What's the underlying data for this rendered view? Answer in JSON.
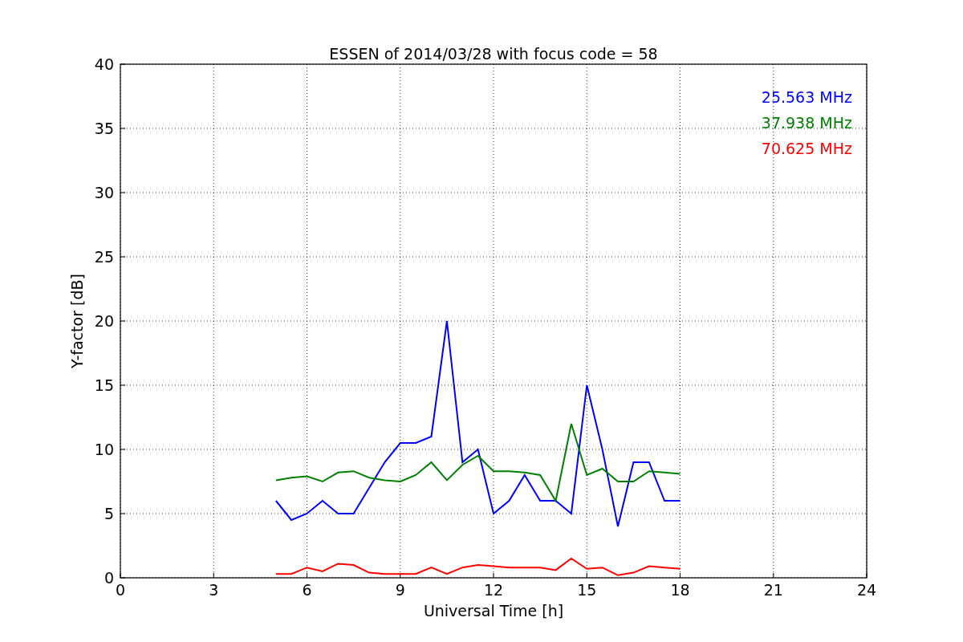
{
  "chart_data": {
    "type": "line",
    "title": "ESSEN of 2014/03/28 with focus code = 58",
    "xlabel": "Universal Time [h]",
    "ylabel": "Y-factor [dB]",
    "x": [
      5,
      5.5,
      6,
      6.5,
      7,
      7.5,
      8,
      8.5,
      9,
      9.5,
      10,
      10.5,
      11,
      11.5,
      12,
      12.5,
      13,
      13.5,
      14,
      14.5,
      15,
      15.5,
      16,
      16.5,
      17,
      17.5,
      18
    ],
    "series": [
      {
        "name": "25.563 MHz",
        "color": "#0000ff",
        "values": [
          6,
          4.5,
          5,
          6,
          5,
          5,
          7,
          9,
          10.5,
          10.5,
          11,
          20,
          9,
          10,
          5,
          6,
          8,
          6,
          6,
          5,
          15,
          10,
          4,
          9,
          9,
          6,
          6
        ]
      },
      {
        "name": "37.938 MHz",
        "color": "#008000",
        "values": [
          7.6,
          7.8,
          7.9,
          7.5,
          8.2,
          8.3,
          7.8,
          7.6,
          7.5,
          8,
          9,
          7.6,
          8.8,
          9.5,
          8.3,
          8.3,
          8.2,
          8,
          6,
          12,
          8,
          8.5,
          7.5,
          7.5,
          8.3,
          8.2,
          8.1
        ]
      },
      {
        "name": "70.625 MHz",
        "color": "#ff0000",
        "values": [
          0.3,
          0.3,
          0.8,
          0.5,
          1.1,
          1,
          0.4,
          0.3,
          0.3,
          0.3,
          0.8,
          0.3,
          0.8,
          1,
          0.9,
          0.8,
          0.8,
          0.8,
          0.6,
          1.5,
          0.7,
          0.8,
          0.2,
          0.4,
          0.9,
          0.8,
          0.7
        ]
      }
    ],
    "xlim": [
      0,
      24
    ],
    "ylim": [
      0,
      40
    ],
    "xticks": [
      0,
      3,
      6,
      9,
      12,
      15,
      18,
      21,
      24
    ],
    "yticks": [
      0,
      5,
      10,
      15,
      20,
      25,
      30,
      35,
      40
    ],
    "grid": true
  }
}
